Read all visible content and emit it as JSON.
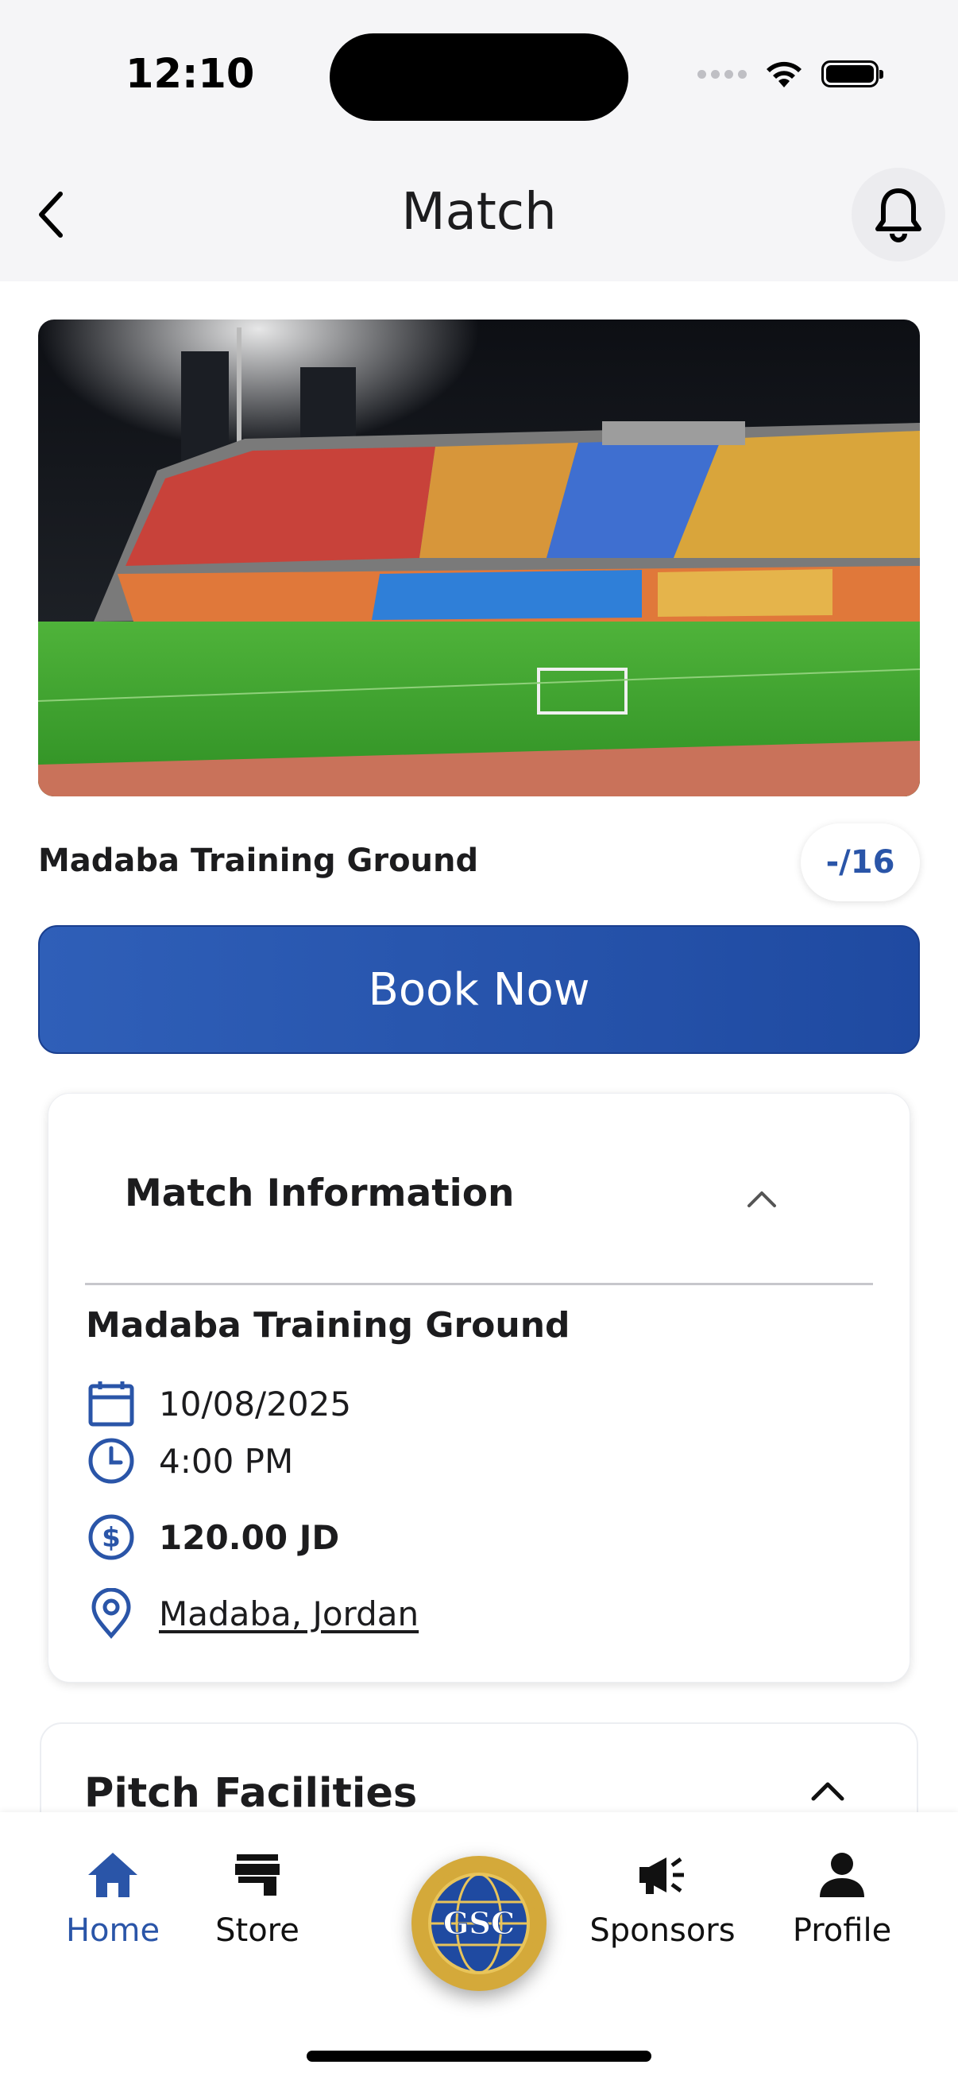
{
  "status_bar": {
    "time": "12:10"
  },
  "header": {
    "title": "Match"
  },
  "venue": {
    "name": "Madaba Training Ground",
    "capacity": "-/16"
  },
  "actions": {
    "book_label": "Book Now"
  },
  "match_info": {
    "section_title": "Match Information",
    "venue_name": "Madaba Training Ground",
    "date": "10/08/2025",
    "time": "4:00 PM",
    "price": "120.00 JD",
    "location": "Madaba, Jordan"
  },
  "facilities": {
    "section_title": "Pitch Facilities"
  },
  "tabbar": {
    "items": [
      {
        "label": "Home",
        "icon": "home-icon",
        "active": true
      },
      {
        "label": "Store",
        "icon": "store-icon",
        "active": false
      },
      {
        "label": "Sponsors",
        "icon": "megaphone-icon",
        "active": false
      },
      {
        "label": "Profile",
        "icon": "person-icon",
        "active": false
      }
    ],
    "center_logo_text": "GSC"
  },
  "colors": {
    "accent": "#2a55a8",
    "button": "#2350a8",
    "background": "#ffffff"
  }
}
